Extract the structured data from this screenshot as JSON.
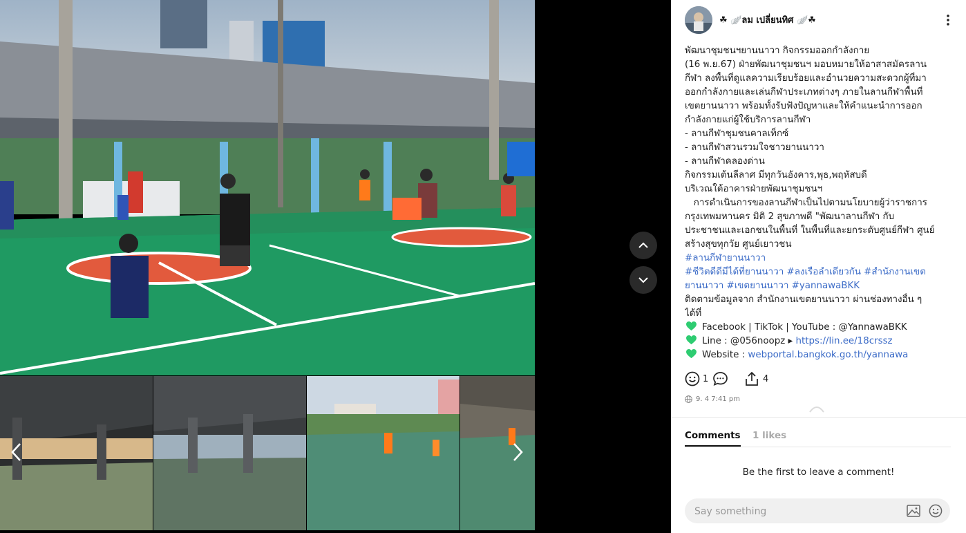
{
  "post": {
    "author": "☘︎ 🪽ลม เปลี่ยนทิศ 🪽☘︎",
    "lines": [
      {
        "text": "พัฒนาชุมชนฯยานนาวา กิจกรรมออกกำลังกาย"
      },
      {
        "text": " (16 พ.ย.67)  ฝ่ายพัฒนาชุมชนฯ มอบหมายให้อาสาสมัครลาน"
      },
      {
        "text": "กีฬา ลงพื้นที่ดูแลความเรียบร้อยและอำนวยความสะดวกผู้ที่มา"
      },
      {
        "text": "ออกกำลังกายและเล่นกีฬาประเภทต่างๆ ภายในลานกีฬาพื้นที่"
      },
      {
        "text": "เขตยานนาวา พร้อมทั้งรับฟังปัญหาและให้คำแนะนำการออก"
      },
      {
        "text": "กำลังกายแก่ผู้ใช้บริการลานกีฬา"
      },
      {
        "text": "- ลานกีฬาชุมชนคาลเท็กซ์"
      },
      {
        "text": "- ลานกีฬาสวนรวมใจชาวยานนาวา"
      },
      {
        "text": "- ลานกีฬาคลองด่าน"
      },
      {
        "text": "กิจกรรมเต้นลีลาศ มีทุกวันอังคาร,พุธ,พฤหัสบดี"
      },
      {
        "text": "บริเวณใต้อาคารฝ่ายพัฒนาชุมชนฯ"
      },
      {
        "text": "   การดำเนินการของลานกีฬาเป็นไปตามนโยบายผู้ว่าราชการ"
      },
      {
        "text": "กรุงเทพมหานคร  มิติ 2 สุขภาพดี  \"พัฒนาลานกีฬา กับ"
      },
      {
        "text": "ประชาชนและเอกชนในพื้นที่ ในพื้นที่และยกระดับศูนย์กีฬา ศูนย์"
      },
      {
        "text": "สร้างสุขทุกวัย ศูนย์เยาวชน"
      }
    ],
    "hashtags": [
      "#ลานกีฬายานนาวา",
      "#ชีวิตดีดีมีได้ที่ยานนาวา #ลงเรือลำเดียวกัน #สำนักงานเขต",
      "ยานนาวา #เขตยานนาวา #yannawaBKK"
    ],
    "follow_lines": [
      "ติดตามข้อมูลจาก สำนักงานเขตยานนาวา ผ่านช่องทางอื่น ๆ",
      "ได้ที่"
    ],
    "contacts": [
      {
        "label": "Facebook | TikTok | YouTube : @YannawaBKK",
        "link": ""
      },
      {
        "label": "Line : @056noopz ▸ ",
        "link": "https://lin.ee/18crssz"
      },
      {
        "label": "Website : ",
        "link": "webportal.bangkok.go.th/yannawa"
      }
    ],
    "reactions_count": "1",
    "shares_count": "4",
    "timestamp": "9. 4 7:41 pm"
  },
  "tabs": {
    "comments": "Comments",
    "likes": "1 likes"
  },
  "empty_message": "Be the first to leave a comment!",
  "comment_placeholder": "Say something",
  "colors": {
    "hashtag": "#3b6bc7",
    "heart": "#2ecc71",
    "court": "#1f9a62"
  }
}
